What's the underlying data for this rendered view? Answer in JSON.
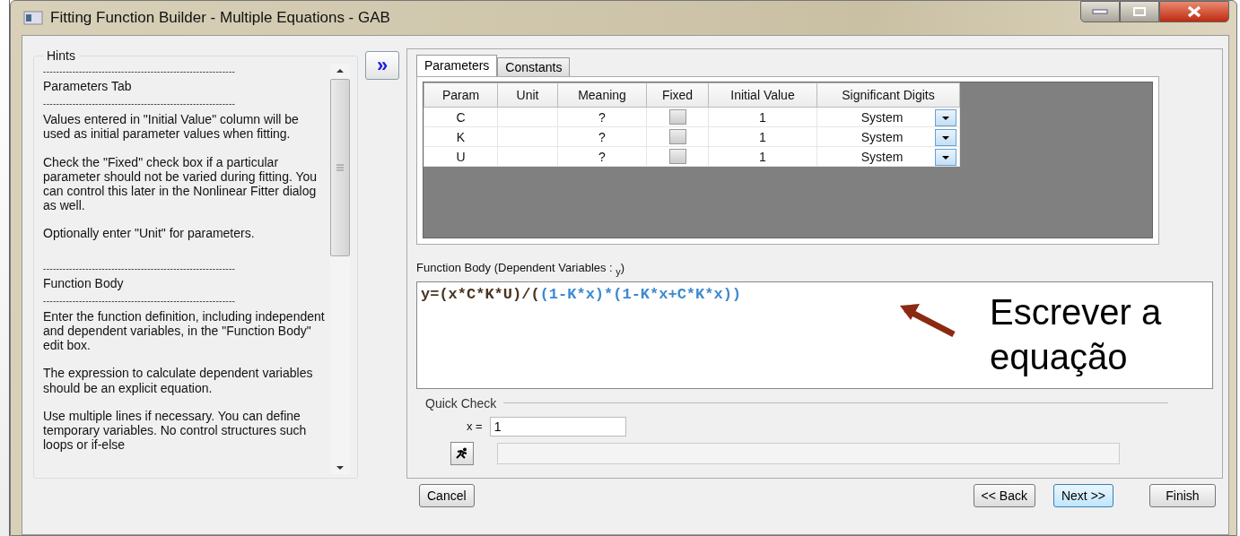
{
  "window": {
    "title": "Fitting Function Builder - Multiple Equations - GAB"
  },
  "hints": {
    "title": "Hints",
    "blocks": [
      {
        "kind": "rule",
        "text": "-----------------------------------------------------------"
      },
      {
        "kind": "heading",
        "text": "Parameters Tab"
      },
      {
        "kind": "rule",
        "text": "-----------------------------------------------------------"
      },
      {
        "kind": "para",
        "text": "Values entered in \"Initial Value\" column will be used as initial parameter values when fitting."
      },
      {
        "kind": "para",
        "text": "Check the \"Fixed\" check box if a particular parameter should not be varied during fitting. You can control this later in the Nonlinear Fitter dialog as well."
      },
      {
        "kind": "para",
        "text": "Optionally enter \"Unit\" for parameters."
      },
      {
        "kind": "gap"
      },
      {
        "kind": "rule",
        "text": "-----------------------------------------------------------"
      },
      {
        "kind": "heading",
        "text": "Function Body"
      },
      {
        "kind": "rule",
        "text": "-----------------------------------------------------------"
      },
      {
        "kind": "para",
        "text": "Enter the function definition, including independent and dependent variables, in the \"Function Body\" edit box."
      },
      {
        "kind": "para",
        "text": "The expression to calculate dependent variables should be an explicit equation."
      },
      {
        "kind": "para",
        "text": "Use multiple lines if necessary. You can define temporary variables. No control structures such loops or if-else"
      }
    ]
  },
  "expand_button": {
    "label": "»"
  },
  "tabs": [
    {
      "label": "Parameters",
      "selected": true
    },
    {
      "label": "Constants",
      "selected": false
    }
  ],
  "table": {
    "columns": [
      "Param",
      "Unit",
      "Meaning",
      "Fixed",
      "Initial Value",
      "Significant Digits"
    ],
    "rows": [
      {
        "param": "C",
        "meaning": "?",
        "fixed": false,
        "initial_value": "1",
        "significant_digits": "System"
      },
      {
        "param": "K",
        "meaning": "?",
        "fixed": false,
        "initial_value": "1",
        "significant_digits": "System"
      },
      {
        "param": "U",
        "meaning": "?",
        "fixed": false,
        "initial_value": "1",
        "significant_digits": "System"
      }
    ]
  },
  "function_body": {
    "label": "Function Body (Dependent Variables : $_{y}$)",
    "segments": [
      {
        "kind": "plain",
        "text": "y=(x*C*K*U)/("
      },
      {
        "kind": "nested",
        "text": "(1-K*x)*(1-K*x+C*K*x))"
      }
    ]
  },
  "annotation": {
    "lines": [
      "Escrever a",
      "equação"
    ]
  },
  "quick_check": {
    "title": "Quick Check",
    "x_label": "x =",
    "x_value": "1"
  },
  "buttons": [
    {
      "label": "Cancel",
      "kind": "left",
      "selected": false
    },
    {
      "label": "<< Back",
      "kind": "right",
      "selected": false
    },
    {
      "label": "Next >>",
      "kind": "right",
      "selected": true
    },
    {
      "label": "Finish",
      "kind": "right",
      "selected": false
    }
  ]
}
